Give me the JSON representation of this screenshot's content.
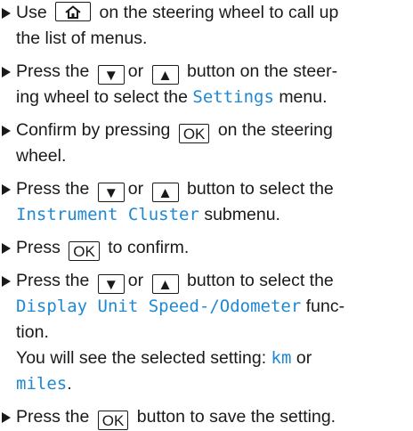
{
  "steps": [
    {
      "l1a": "Use",
      "home_icon": "home-icon",
      "l1b": "on the steering wheel to call up",
      "l2": "the list of menus."
    },
    {
      "l1a": "Press the",
      "down": "▼",
      "or": "or",
      "up": "▲",
      "l1b": "button on the steer-",
      "l2a": "ing wheel to select the",
      "menu": "Settings",
      "l2b": "menu."
    },
    {
      "l1a": "Confirm by pressing",
      "ok": "OK",
      "l1b": "on the steering",
      "l2": "wheel."
    },
    {
      "l1a": "Press the",
      "down": "▼",
      "or": "or",
      "up": "▲",
      "l1b": "button to select the",
      "menu": "Instrument Cluster",
      "l2b": "submenu."
    },
    {
      "l1a": "Press",
      "ok": "OK",
      "l1b": "to confirm."
    },
    {
      "l1a": "Press the",
      "down": "▼",
      "or": "or",
      "up": "▲",
      "l1b": "button to select the",
      "menu": "Display Unit Speed-/Odometer",
      "l2b": "func-",
      "l3": "tion.",
      "l4": "You will see the selected setting:",
      "opt1": "km",
      "l4b": "or",
      "opt2": "miles",
      "l5b": "."
    },
    {
      "l1a": "Press the",
      "ok": "OK",
      "l1b": "button to save the setting."
    }
  ]
}
